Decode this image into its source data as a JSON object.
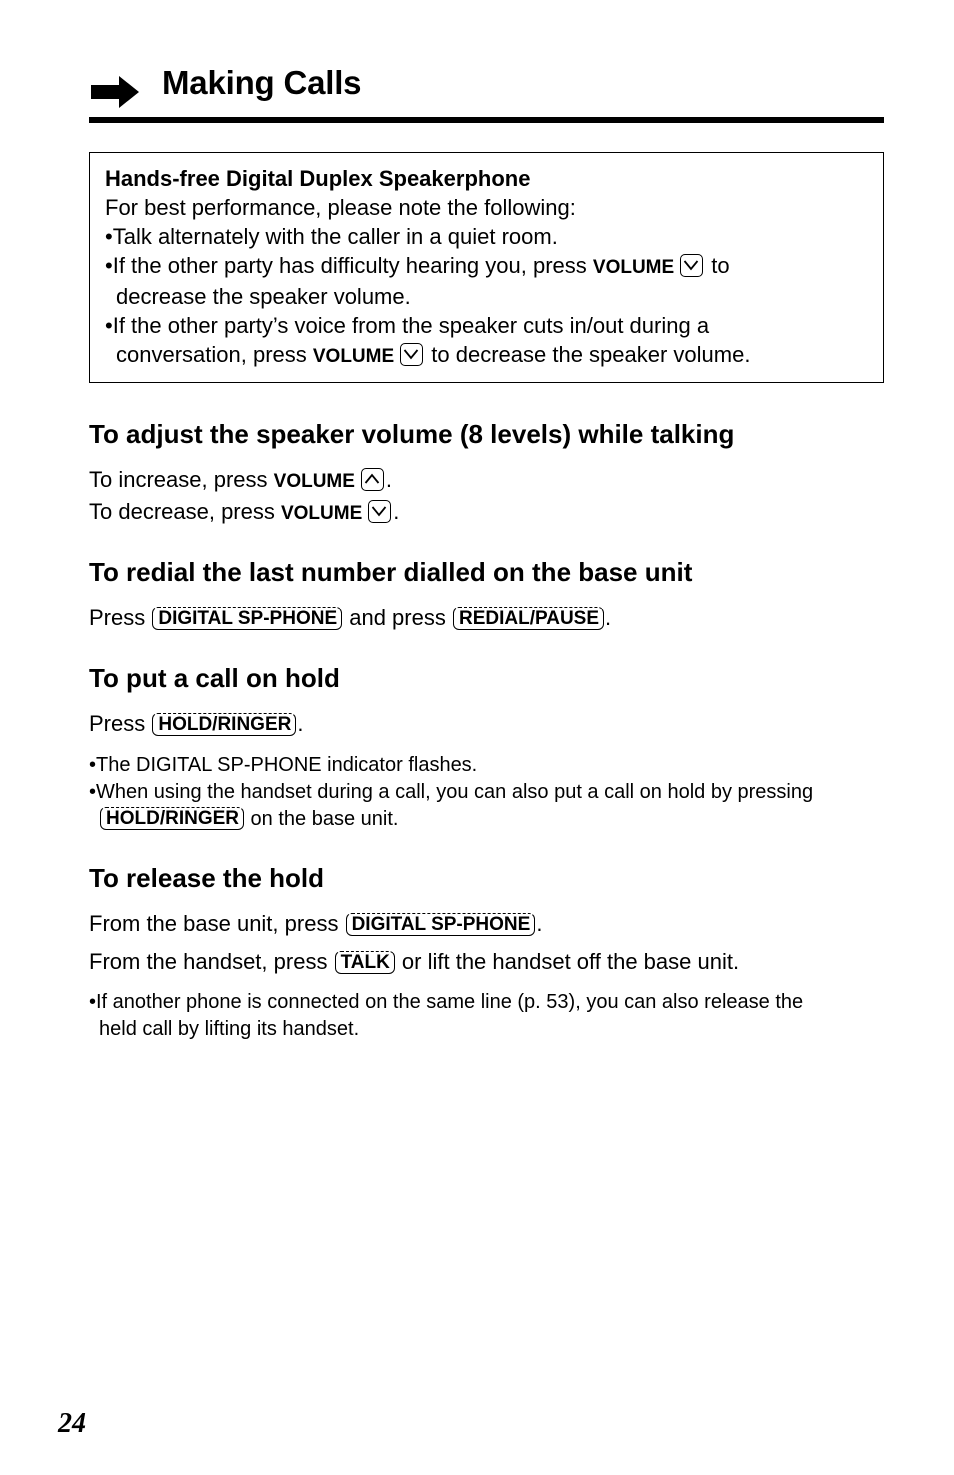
{
  "header": {
    "icon": "arrow-right-icon",
    "title": "Making Calls"
  },
  "notebox": {
    "title": "Hands-free Digital Duplex Speakerphone",
    "intro": "For best performance, please note the following:",
    "bullet1": "•Talk alternately with the caller in a quiet room.",
    "bullet2_a": "•If the other party has difficulty hearing you, press ",
    "bullet2_kw": "VOLUME",
    "bullet2_b": " to",
    "bullet2_c": "decrease the speaker volume.",
    "bullet3_a": "•If the other party’s voice from the speaker cuts in/out during a",
    "bullet3_b": "conversation, press ",
    "bullet3_kw": "VOLUME",
    "bullet3_c": " to decrease the speaker volume."
  },
  "sections": {
    "volume": {
      "heading": "To adjust the speaker volume (8 levels) while talking",
      "line1_a": "To increase, press ",
      "line1_kw": "VOLUME",
      "line1_b": ".",
      "line2_a": "To decrease, press ",
      "line2_kw": "VOLUME",
      "line2_b": "."
    },
    "redial": {
      "heading": "To redial the last number dialled on the base unit",
      "text_a": "Press ",
      "key1": "DIGITAL SP-PHONE",
      "text_b": " and press ",
      "key2": "REDIAL/PAUSE",
      "text_c": "."
    },
    "hold": {
      "heading": "To put a call on hold",
      "text_a": "Press ",
      "key1": "HOLD/RINGER",
      "text_b": ".",
      "note1": "•The DIGITAL SP-PHONE indicator flashes.",
      "note2_a": "•When using the handset during a call, you can also put a call on hold by pressing",
      "note2_key": "HOLD/RINGER",
      "note2_b": " on the base unit."
    },
    "release": {
      "heading": "To release the hold",
      "line1_a": "From the base unit, press ",
      "line1_key": "DIGITAL SP-PHONE",
      "line1_b": ".",
      "line2_a": "From the handset, press ",
      "line2_key": "TALK",
      "line2_b": " or lift the handset off the base unit.",
      "note_a": "•If another phone is connected on the same line (p. 53), you can also release the",
      "note_b": "held call by lifting its handset."
    }
  },
  "footer": {
    "page_number": "24"
  }
}
